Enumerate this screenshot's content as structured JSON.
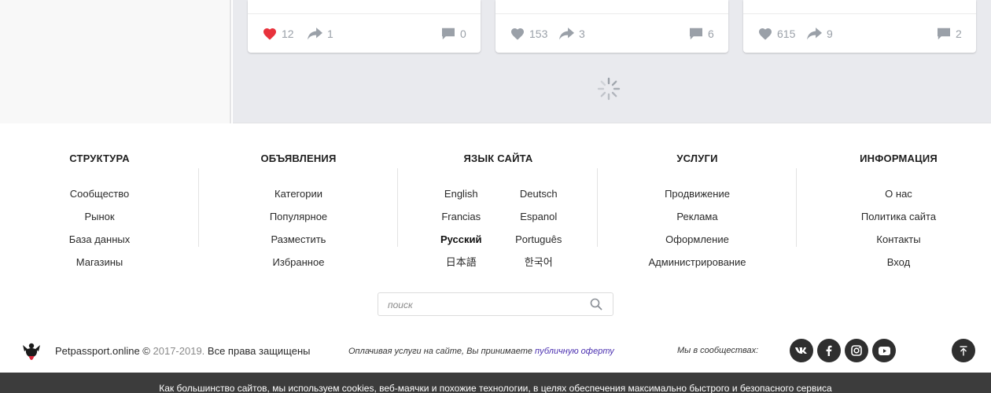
{
  "cards": [
    {
      "likes": "12",
      "shares": "1",
      "comments": "0",
      "liked": true
    },
    {
      "likes": "153",
      "shares": "3",
      "comments": "6",
      "liked": false
    },
    {
      "likes": "615",
      "shares": "9",
      "comments": "2",
      "liked": false
    }
  ],
  "colors": {
    "heart_active": "#e8323c",
    "icon_gray": "#9aa0a8",
    "dark_button": "#2f2f2f",
    "cookie_bg": "#3c3c3c",
    "link_accent": "#4a2fb0"
  },
  "footer": {
    "structure": {
      "title": "СТРУКТУРА",
      "items": [
        "Сообщество",
        "Рынок",
        "База данных",
        "Магазины"
      ]
    },
    "ads": {
      "title": "ОБЪЯВЛЕНИЯ",
      "items": [
        "Категории",
        "Популярное",
        "Разместить",
        "Избранное"
      ]
    },
    "language": {
      "title": "ЯЗЫК САЙТА",
      "items": [
        "English",
        "Deutsch",
        "Francias",
        "Espanol",
        "Русский",
        "Português",
        "日本語",
        "한국어"
      ],
      "active": "Русский"
    },
    "services": {
      "title": "УСЛУГИ",
      "items": [
        "Продвижение",
        "Реклама",
        "Оформление",
        "Администрирование"
      ]
    },
    "info": {
      "title": "ИНФОРМАЦИЯ",
      "items": [
        "О нас",
        "Политика сайта",
        "Контакты",
        "Вход"
      ]
    }
  },
  "search": {
    "placeholder": "поиск"
  },
  "bottom": {
    "site": "Petpassport.online ©",
    "years": "2017-2019.",
    "rights": "Все права защищены",
    "offer_text": "Оплачивая услуги на сайте, Вы принимаете",
    "offer_link": "публичную оферту",
    "community_label": "Мы в сообществах:",
    "socials": [
      "vk-icon",
      "facebook-icon",
      "instagram-icon",
      "youtube-icon"
    ]
  },
  "cookie_text": "Как большинство сайтов, мы используем cookies, веб-маячки и похожие технологии, в целях обеспечения максимально быстрого и безопасного сервиса"
}
